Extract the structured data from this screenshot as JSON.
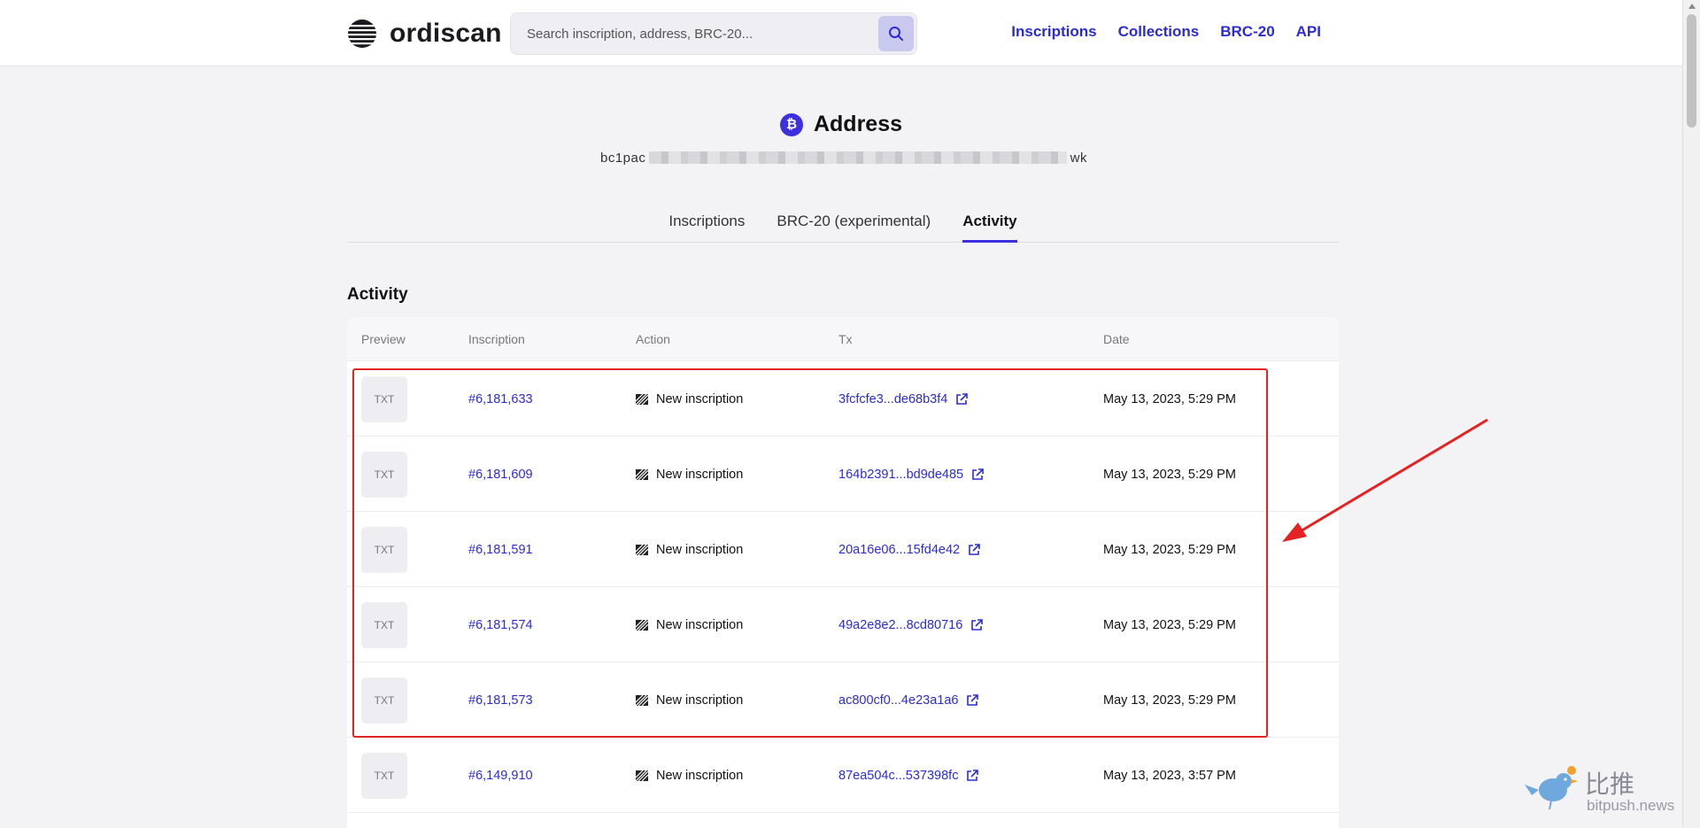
{
  "header": {
    "brand": "ordiscan",
    "search_placeholder": "Search inscription, address, BRC-20...",
    "nav": [
      "Inscriptions",
      "Collections",
      "BRC-20",
      "API"
    ]
  },
  "address": {
    "title": "Address",
    "btc_symbol": "₿",
    "start": "bc1pac",
    "end": "wk"
  },
  "tabs": [
    {
      "label": "Inscriptions",
      "active": false
    },
    {
      "label": "BRC-20 (experimental)",
      "active": false
    },
    {
      "label": "Activity",
      "active": true
    }
  ],
  "section": {
    "title": "Activity",
    "columns": [
      "Preview",
      "Inscription",
      "Action",
      "Tx",
      "Date"
    ]
  },
  "rows": [
    {
      "preview": "TXT",
      "inscription": "#6,181,633",
      "action": "New inscription",
      "tx": "3fcfcfe3...de68b3f4",
      "date": "May 13, 2023, 5:29 PM"
    },
    {
      "preview": "TXT",
      "inscription": "#6,181,609",
      "action": "New inscription",
      "tx": "164b2391...bd9de485",
      "date": "May 13, 2023, 5:29 PM"
    },
    {
      "preview": "TXT",
      "inscription": "#6,181,591",
      "action": "New inscription",
      "tx": "20a16e06...15fd4e42",
      "date": "May 13, 2023, 5:29 PM"
    },
    {
      "preview": "TXT",
      "inscription": "#6,181,574",
      "action": "New inscription",
      "tx": "49a2e8e2...8cd80716",
      "date": "May 13, 2023, 5:29 PM"
    },
    {
      "preview": "TXT",
      "inscription": "#6,181,573",
      "action": "New inscription",
      "tx": "ac800cf0...4e23a1a6",
      "date": "May 13, 2023, 5:29 PM"
    },
    {
      "preview": "TXT",
      "inscription": "#6,149,910",
      "action": "New inscription",
      "tx": "87ea504c...537398fc",
      "date": "May 13, 2023, 3:57 PM"
    }
  ],
  "watermark": {
    "text": "比推",
    "sub": "bitpush.news"
  },
  "colors": {
    "accent": "#3b2fe0",
    "link": "#2b2bd6",
    "highlight": "#e52222"
  }
}
